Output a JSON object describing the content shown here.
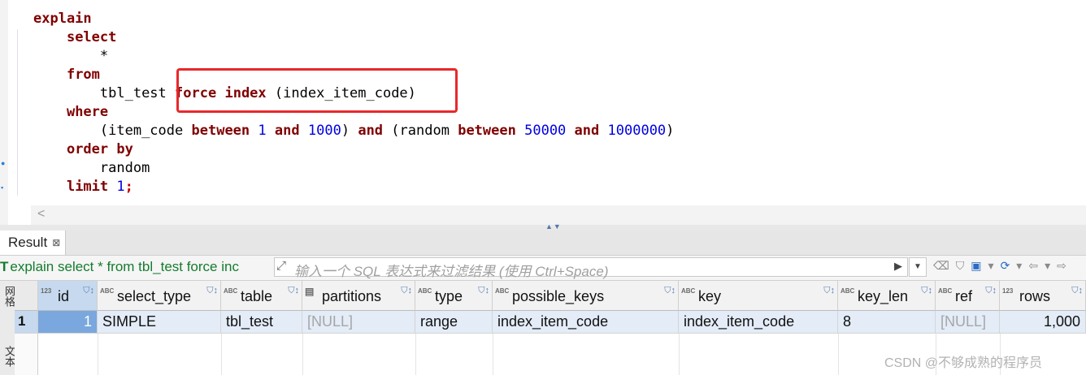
{
  "editor": {
    "lines": {
      "l1": "explain",
      "l2": "select",
      "l3": "*",
      "l4": "from",
      "l5_table": "tbl_test",
      "l5_force": "force",
      "l5_index": "index",
      "l5_name": "(index_item_code)",
      "l6": "where",
      "l7_a": "(item_code",
      "l7_between": "between",
      "l7_n1": "1",
      "l7_and": "and",
      "l7_n2": "1000",
      "l7_close": ")",
      "l7_and2": "and",
      "l7_b": "(random",
      "l7_between2": "between",
      "l7_n3": "50000",
      "l7_and3": "and",
      "l7_n4": "1000000",
      "l7_close2": ")",
      "l8": "order by",
      "l9": "random",
      "l10_limit": "limit",
      "l10_n": "1",
      "l10_semi": ";"
    },
    "highlight_color": "#e8282b",
    "scroll_left": "<"
  },
  "result": {
    "tab_label": "Result",
    "tab_close": "⊠",
    "query_text": "explain select * from tbl_test force inc",
    "filter_placeholder": "输入一个 SQL 表达式来过滤结果 (使用 Ctrl+Space)",
    "side_text_1": "网格",
    "side_text_2": "文本"
  },
  "grid": {
    "columns": [
      {
        "type": "123",
        "name": "id"
      },
      {
        "type": "ABC",
        "name": "select_type"
      },
      {
        "type": "ABC",
        "name": "table"
      },
      {
        "type": "",
        "name": "partitions"
      },
      {
        "type": "ABC",
        "name": "type"
      },
      {
        "type": "ABC",
        "name": "possible_keys"
      },
      {
        "type": "ABC",
        "name": "key"
      },
      {
        "type": "ABC",
        "name": "key_len"
      },
      {
        "type": "ABC",
        "name": "ref"
      },
      {
        "type": "123",
        "name": "rows"
      }
    ],
    "row_number": "1",
    "row": {
      "id": "1",
      "select_type": "SIMPLE",
      "table": "tbl_test",
      "partitions": "[NULL]",
      "type": "range",
      "possible_keys": "index_item_code",
      "key": "index_item_code",
      "key_len": "8",
      "ref": "[NULL]",
      "rows": "1,000"
    }
  },
  "watermark": "CSDN @不够成熟的程序员"
}
